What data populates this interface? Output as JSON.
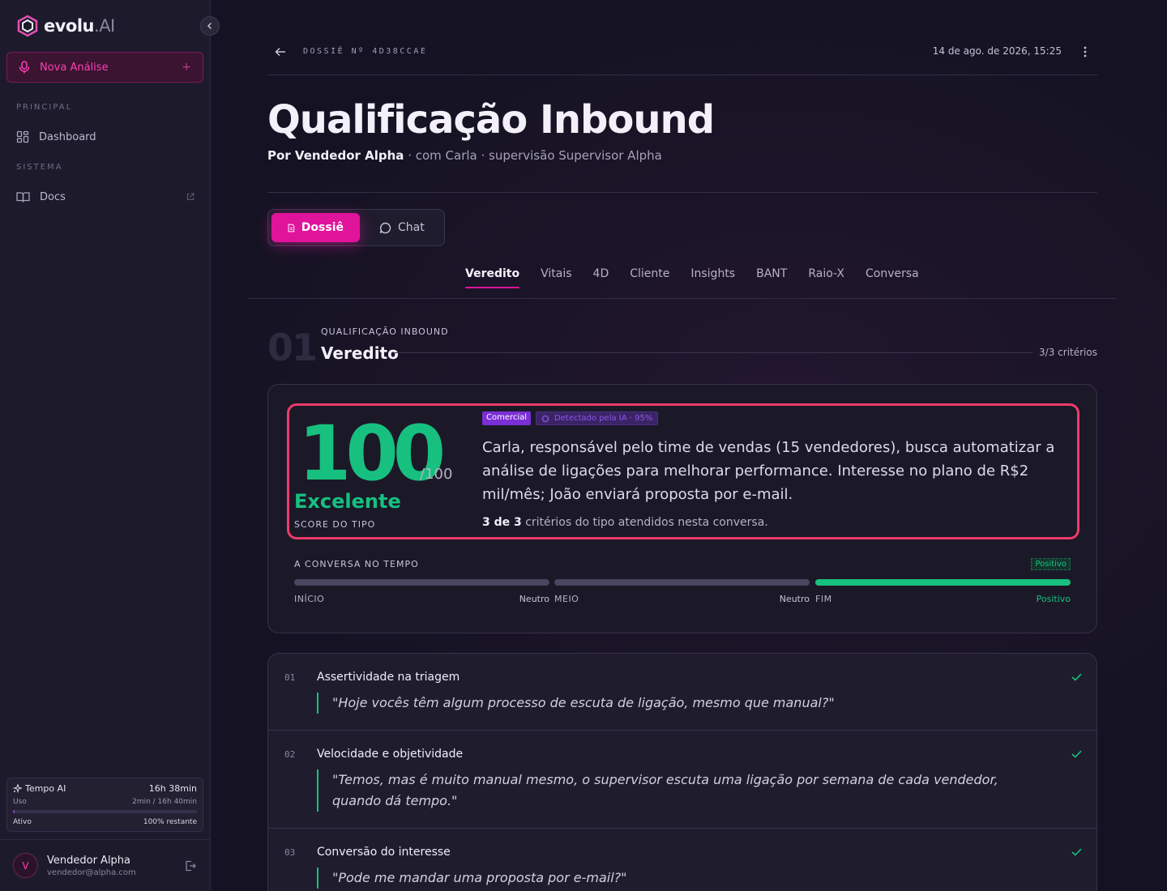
{
  "sidebar": {
    "logo": {
      "brand": "evolu",
      "suffix": ".AI"
    },
    "new_analysis": {
      "label": "Nova Análise",
      "plus": "+"
    },
    "sections": [
      {
        "label": "PRINCIPAL",
        "items": [
          {
            "label": "Dashboard",
            "icon": "grid-icon"
          }
        ]
      },
      {
        "label": "SISTEMA",
        "items": [
          {
            "label": "Docs",
            "icon": "book-icon",
            "external": true
          }
        ]
      }
    ],
    "tempo": {
      "title": "Tempo AI",
      "total": "16h 38min",
      "usage_label": "Uso",
      "usage_value": "2min / 16h 40min",
      "usage_fraction": 0.002,
      "status_label": "Ativo",
      "status_value": "100% restante"
    },
    "user": {
      "initial": "V",
      "name": "Vendedor Alpha",
      "email": "vendedor@alpha.com"
    }
  },
  "header": {
    "dossie_id": "DOSSIÊ Nº 4D38CCAE",
    "datetime": "14 de ago. de 2026, 15:25"
  },
  "page": {
    "title": "Qualificação Inbound",
    "subtitle_by": "Por Vendedor Alpha",
    "subtitle_rest": " · com Carla · supervisão Supervisor Alpha"
  },
  "modes": [
    {
      "label": "Dossiê",
      "active": true
    },
    {
      "label": "Chat",
      "active": false
    }
  ],
  "tabs": [
    "Veredito",
    "Vitais",
    "4D",
    "Cliente",
    "Insights",
    "BANT",
    "Raio-X",
    "Conversa"
  ],
  "active_tab": "Veredito",
  "section": {
    "number": "01",
    "kicker": "QUALIFICAÇÃO INBOUND",
    "title": "Veredito",
    "count": "3/3 critérios"
  },
  "verdict": {
    "score": "100",
    "score_max": "/100",
    "rating": "Excelente",
    "score_kicker": "SCORE DO TIPO",
    "badge_type": "Comercial",
    "badge_ai": "Detectado pela IA · 95%",
    "summary": "Carla, responsável pelo time de vendas (15 vendedores), busca automatizar a análise de ligações para melhorar performance. Interesse no plano de R$2 mil/mês; João enviará proposta por e-mail.",
    "criteria_met": "3 de 3",
    "criteria_rest": " critérios do tipo atendidos nesta conversa.",
    "timeline": {
      "kicker": "A CONVERSA NO TEMPO",
      "overall": "Positivo",
      "segments": [
        {
          "label": "INÍCIO",
          "sentiment": "Neutro",
          "color": "#4a4660"
        },
        {
          "label": "MEIO",
          "sentiment": "Neutro",
          "color": "#4a4660"
        },
        {
          "label": "FIM",
          "sentiment": "Positivo",
          "color": "#17c07f"
        }
      ]
    }
  },
  "criteria": [
    {
      "num": "01",
      "title": "Assertividade na triagem",
      "quote": "\"Hoje vocês têm algum processo de escuta de ligação, mesmo que manual?\""
    },
    {
      "num": "02",
      "title": "Velocidade e objetividade",
      "quote": "\"Temos, mas é muito manual mesmo, o supervisor escuta uma ligação por semana de cada vendedor, quando dá tempo.\""
    },
    {
      "num": "03",
      "title": "Conversão do interesse",
      "quote": "\"Pode me mandar uma proposta por e-mail?\""
    }
  ],
  "colors": {
    "accent": "#e0139b",
    "positive": "#17c07f",
    "highlight": "#ef3b6b"
  }
}
